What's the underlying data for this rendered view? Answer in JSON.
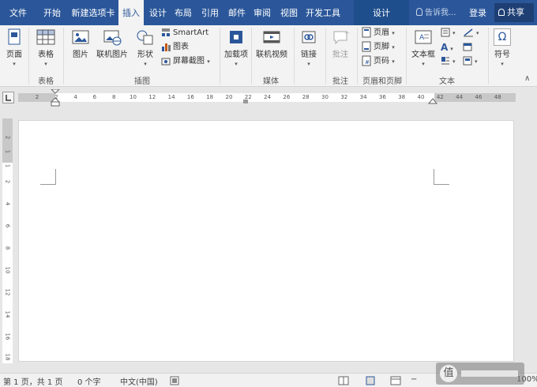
{
  "tabs": [
    "文件",
    "开始",
    "新建选项卡",
    "插入",
    "设计",
    "布局",
    "引用",
    "邮件",
    "审阅",
    "视图",
    "开发工具"
  ],
  "active_tab": "插入",
  "context_tab": "设计",
  "tell_me": "告诉我...",
  "login": "登录",
  "share": "共享",
  "ribbon": {
    "pages": {
      "btn": "页面",
      "group": ""
    },
    "tables": {
      "btn": "表格",
      "group": "表格"
    },
    "illus": {
      "pictures": "图片",
      "online_pictures": "联机图片",
      "shapes": "形状",
      "smartart": "SmartArt",
      "chart": "图表",
      "screenshot": "屏幕截图",
      "group": "插图"
    },
    "addins": {
      "btn": "加载项"
    },
    "media": {
      "btn": "联机视频",
      "group": "媒体"
    },
    "links": {
      "btn": "链接"
    },
    "comments": {
      "btn": "批注",
      "group": "批注"
    },
    "hf": {
      "header": "页眉",
      "footer": "页脚",
      "pagenum": "页码",
      "group": "页眉和页脚"
    },
    "text": {
      "textbox": "文本框",
      "group": "文本"
    },
    "symbols": {
      "btn": "符号",
      "omega": "Ω"
    }
  },
  "ruler_ticks": [
    "2",
    "2",
    "4",
    "6",
    "8",
    "10",
    "12",
    "14",
    "16",
    "18",
    "20",
    "22",
    "24",
    "26",
    "28",
    "30",
    "32",
    "34",
    "36",
    "38",
    "40",
    "42",
    "44",
    "46",
    "48"
  ],
  "vruler_ticks": [
    "2",
    "1",
    "1",
    "2",
    "4",
    "6",
    "8",
    "10",
    "12",
    "14",
    "16",
    "18"
  ],
  "status": {
    "page": "第 1 页，共 1 页",
    "words": "0 个字",
    "lang": "中文(中国)",
    "zoom": "100%"
  },
  "watermark_glyph": "值",
  "colors": {
    "accent": "#2b579a",
    "ribbon_bg": "#f3f3f3",
    "page": "#ffffff"
  }
}
